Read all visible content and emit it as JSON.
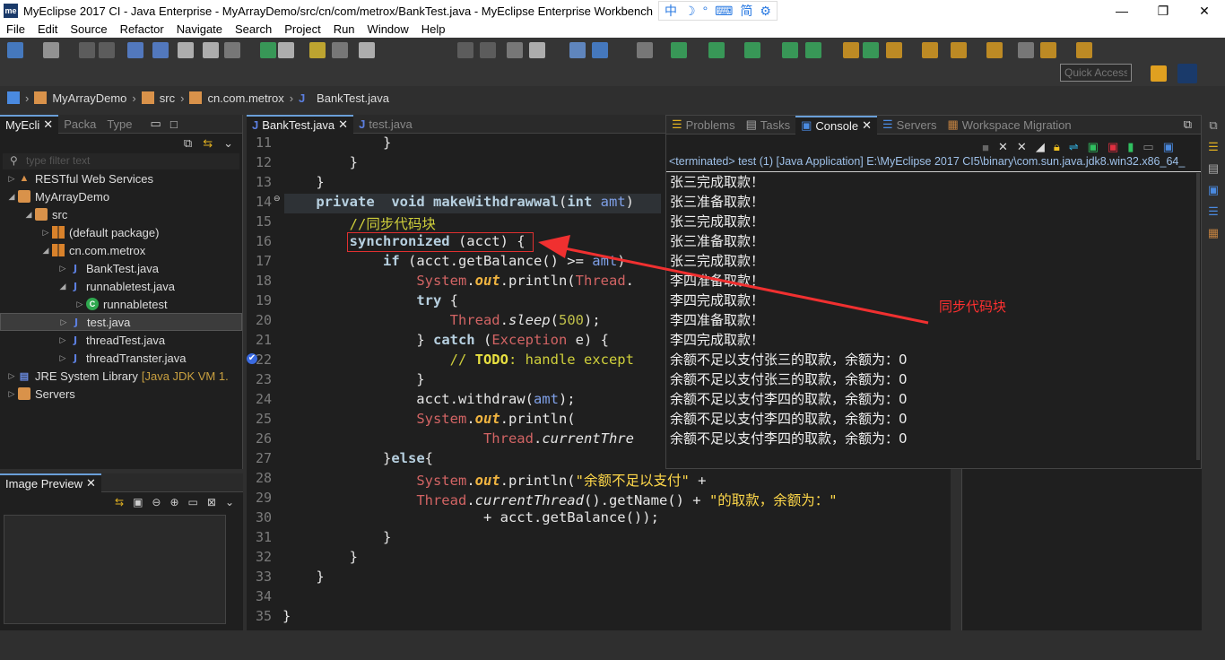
{
  "window": {
    "title": "MyEclipse 2017 CI - Java Enterprise - MyArrayDemo/src/cn/com/metrox/BankTest.java - MyEclipse Enterprise Workbench",
    "logo": "me",
    "ime": [
      "中",
      "☽",
      "°",
      "⌨",
      "简",
      "⚙"
    ]
  },
  "menu": [
    "File",
    "Edit",
    "Source",
    "Refactor",
    "Navigate",
    "Search",
    "Project",
    "Run",
    "Window",
    "Help"
  ],
  "toolbar": {
    "quick_access_placeholder": "Quick Access"
  },
  "breadcrumb": [
    "MyArrayDemo",
    "src",
    "cn.com.metrox",
    "BankTest.java"
  ],
  "left_panel": {
    "tabs": [
      "MyEcli",
      "Packa",
      "Type"
    ],
    "filter_placeholder": "type filter text",
    "tree": [
      {
        "label": "RESTful Web Services",
        "depth": 0,
        "twisty": "▷",
        "icon": "rest"
      },
      {
        "label": "MyArrayDemo",
        "depth": 0,
        "twisty": "◢",
        "icon": "fold"
      },
      {
        "label": "src",
        "depth": 1,
        "twisty": "◢",
        "icon": "fold"
      },
      {
        "label": "(default package)",
        "depth": 2,
        "twisty": "▷",
        "icon": "pkg"
      },
      {
        "label": "cn.com.metrox",
        "depth": 2,
        "twisty": "◢",
        "icon": "pkg"
      },
      {
        "label": "BankTest.java",
        "depth": 3,
        "twisty": "▷",
        "icon": "j"
      },
      {
        "label": "runnabletest.java",
        "depth": 3,
        "twisty": "◢",
        "icon": "j"
      },
      {
        "label": "runnabletest",
        "depth": 4,
        "twisty": "▷",
        "icon": "c"
      },
      {
        "label": "test.java",
        "depth": 3,
        "twisty": "▷",
        "icon": "j",
        "selected": true
      },
      {
        "label": "threadTest.java",
        "depth": 3,
        "twisty": "▷",
        "icon": "j"
      },
      {
        "label": "threadTranster.java",
        "depth": 3,
        "twisty": "▷",
        "icon": "j"
      },
      {
        "label": "JRE System Library",
        "extra": "[Java JDK VM 1.",
        "depth": 0,
        "twisty": "▷",
        "icon": "lib"
      },
      {
        "label": "Servers",
        "depth": 0,
        "twisty": "▷",
        "icon": "fold"
      }
    ]
  },
  "image_preview": {
    "title": "Image Preview"
  },
  "editor": {
    "tabs": [
      "BankTest.java",
      "test.java"
    ],
    "lines": [
      {
        "n": "11",
        "t": [
          [
            "            }",
            ""
          ]
        ]
      },
      {
        "n": "12",
        "t": [
          [
            "        }",
            ""
          ]
        ]
      },
      {
        "n": "13",
        "t": [
          [
            "    }",
            ""
          ]
        ]
      },
      {
        "n": "14",
        "t": [
          [
            "    ",
            ""
          ],
          [
            "private",
            "k"
          ],
          [
            "  ",
            ""
          ],
          [
            "void",
            "k"
          ],
          [
            " ",
            ""
          ],
          [
            "makeWithdrawwal",
            "k"
          ],
          [
            "(",
            ""
          ],
          [
            "int",
            "k"
          ],
          [
            " ",
            ""
          ],
          [
            "amt",
            "p"
          ],
          [
            ")",
            ""
          ]
        ]
      },
      {
        "n": "15",
        "t": [
          [
            "        ",
            ""
          ],
          [
            "//同步代码块",
            "cm"
          ]
        ]
      },
      {
        "n": "16",
        "t": [
          [
            "        ",
            ""
          ],
          [
            "synchronized",
            "k"
          ],
          [
            " (acct) {",
            ""
          ]
        ]
      },
      {
        "n": "17",
        "t": [
          [
            "            ",
            ""
          ],
          [
            "if",
            "k"
          ],
          [
            " (acct.getBalance() >= ",
            ""
          ],
          [
            "amt",
            "p"
          ],
          [
            ")",
            ""
          ]
        ]
      },
      {
        "n": "18",
        "t": [
          [
            "                ",
            ""
          ],
          [
            "System",
            "cl"
          ],
          [
            ".",
            ""
          ],
          [
            "out",
            "st"
          ],
          [
            ".println(",
            ""
          ],
          [
            "Thread",
            "cl"
          ],
          [
            ".",
            ""
          ]
        ]
      },
      {
        "n": "19",
        "t": [
          [
            "                ",
            ""
          ],
          [
            "try",
            "k"
          ],
          [
            " {",
            ""
          ]
        ]
      },
      {
        "n": "20",
        "t": [
          [
            "                    ",
            ""
          ],
          [
            "Thread",
            "cl"
          ],
          [
            ".",
            ""
          ],
          [
            "sleep",
            "it"
          ],
          [
            "(",
            ""
          ],
          [
            "500",
            "n"
          ],
          [
            ");",
            ""
          ]
        ]
      },
      {
        "n": "21",
        "t": [
          [
            "                ",
            ""
          ],
          [
            "} ",
            ""
          ],
          [
            "catch",
            "k"
          ],
          [
            " (",
            ""
          ],
          [
            "Exception",
            "cl"
          ],
          [
            " e) {",
            ""
          ]
        ]
      },
      {
        "n": "22",
        "t": [
          [
            "                    ",
            ""
          ],
          [
            "// ",
            "cm"
          ],
          [
            "TODO",
            "td"
          ],
          [
            ": handle except",
            "cm"
          ]
        ]
      },
      {
        "n": "23",
        "t": [
          [
            "                }",
            ""
          ]
        ]
      },
      {
        "n": "24",
        "t": [
          [
            "                acct.withdraw(",
            ""
          ],
          [
            "amt",
            "p"
          ],
          [
            ");",
            ""
          ]
        ]
      },
      {
        "n": "25",
        "t": [
          [
            "                ",
            ""
          ],
          [
            "System",
            "cl"
          ],
          [
            ".",
            ""
          ],
          [
            "out",
            "st"
          ],
          [
            ".println(",
            ""
          ]
        ]
      },
      {
        "n": "26",
        "t": [
          [
            "                        ",
            ""
          ],
          [
            "Thread",
            "cl"
          ],
          [
            ".",
            ""
          ],
          [
            "currentThre",
            "it"
          ]
        ]
      },
      {
        "n": "27",
        "t": [
          [
            "            }",
            ""
          ],
          [
            "else",
            "k"
          ],
          [
            "{",
            ""
          ]
        ]
      },
      {
        "n": "28",
        "t": [
          [
            "                ",
            ""
          ],
          [
            "System",
            "cl"
          ],
          [
            ".",
            ""
          ],
          [
            "out",
            "st"
          ],
          [
            ".println(",
            ""
          ],
          [
            "\"余额不足以支付\"",
            "s"
          ],
          [
            " +",
            ""
          ]
        ]
      },
      {
        "n": "29",
        "t": [
          [
            "                ",
            ""
          ],
          [
            "Thread",
            "cl"
          ],
          [
            ".",
            ""
          ],
          [
            "currentThread",
            "it"
          ],
          [
            "().getName() + ",
            ""
          ],
          [
            "\"的取款，余额为：\"",
            "s"
          ]
        ]
      },
      {
        "n": "30",
        "t": [
          [
            "                        + acct.getBalance());",
            ""
          ]
        ]
      },
      {
        "n": "31",
        "t": [
          [
            "            }",
            ""
          ]
        ]
      },
      {
        "n": "32",
        "t": [
          [
            "        }",
            ""
          ]
        ]
      },
      {
        "n": "33",
        "t": [
          [
            "    }",
            ""
          ]
        ]
      },
      {
        "n": "34",
        "t": [
          [
            "",
            ""
          ]
        ]
      },
      {
        "n": "35",
        "t": [
          [
            "}",
            ""
          ]
        ]
      }
    ]
  },
  "console": {
    "tabs": [
      "Problems",
      "Tasks",
      "Console",
      "Servers",
      "Workspace Migration"
    ],
    "header": "<terminated> test (1) [Java Application] E:\\MyEclipse 2017 CI5\\binary\\com.sun.java.jdk8.win32.x86_64_",
    "lines": [
      "张三完成取款！",
      "张三准备取款！",
      "张三完成取款！",
      "张三准备取款！",
      "张三完成取款！",
      "李四准备取款！",
      "李四完成取款！",
      "李四准备取款！",
      "李四完成取款！",
      "余额不足以支付张三的取款，余额为：0",
      "余额不足以支付张三的取款，余额为：0",
      "余额不足以支付李四的取款，余额为：0",
      "余额不足以支付李四的取款，余额为：0",
      "余额不足以支付李四的取款，余额为：0"
    ]
  },
  "annotation": {
    "text": "同步代码块",
    "color": "#ff3030"
  }
}
